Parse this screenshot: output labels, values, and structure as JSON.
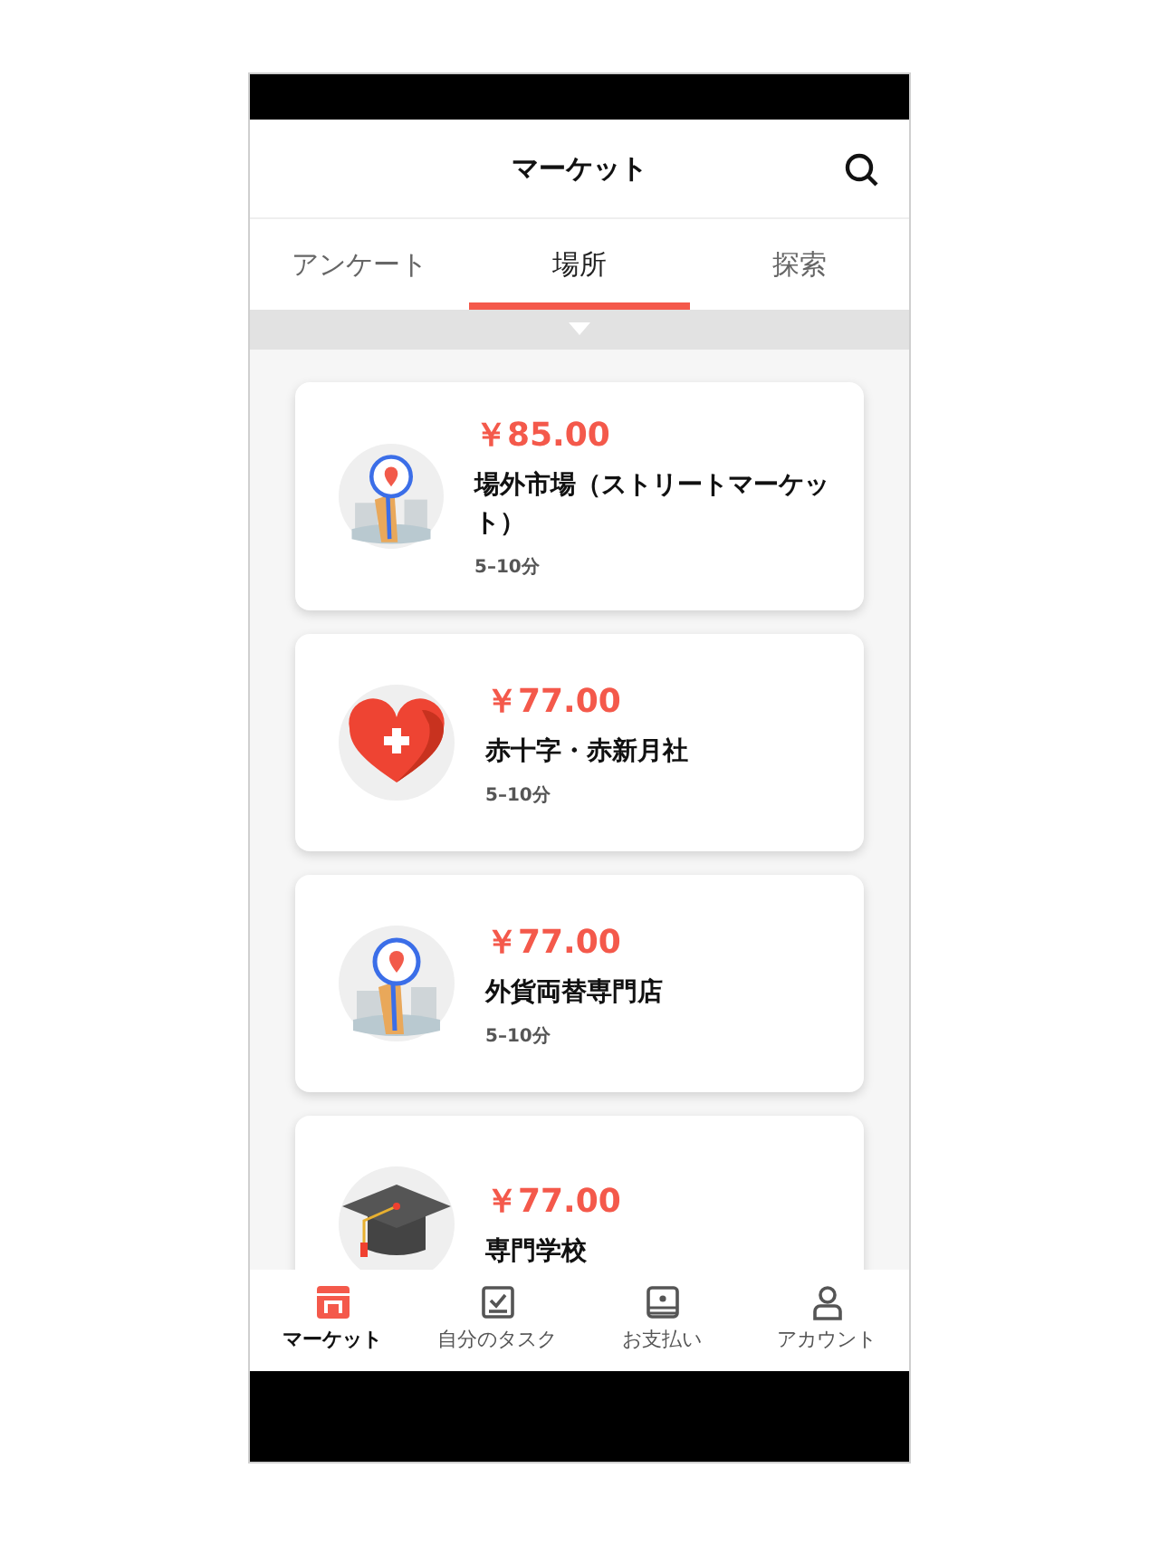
{
  "header": {
    "title": "マーケット"
  },
  "tabs": [
    {
      "label": "アンケート",
      "selected": false
    },
    {
      "label": "場所",
      "selected": true
    },
    {
      "label": "探索",
      "selected": false
    }
  ],
  "cards": [
    {
      "kind": "map",
      "price": "￥85.00",
      "name": "場外市場（ストリートマーケット）",
      "time": "5–10分"
    },
    {
      "kind": "heart",
      "price": "￥77.00",
      "name": "赤十字・赤新月社",
      "time": "5–10分"
    },
    {
      "kind": "map",
      "price": "￥77.00",
      "name": "外貨両替専門店",
      "time": "5–10分"
    },
    {
      "kind": "cap",
      "price": "￥77.00",
      "name": "専門学校"
    }
  ],
  "nav": [
    {
      "kind": "shop",
      "label": "マーケット",
      "selected": true
    },
    {
      "kind": "task",
      "label": "自分のタスク",
      "selected": false
    },
    {
      "kind": "pay",
      "label": "お支払い",
      "selected": false
    },
    {
      "kind": "account",
      "label": "アカウント",
      "selected": false
    }
  ]
}
